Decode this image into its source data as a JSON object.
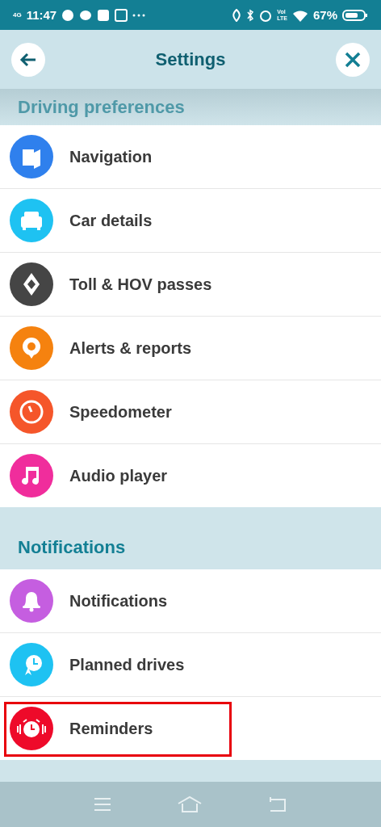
{
  "status_bar": {
    "network": "4G",
    "time": "11:47",
    "volte": [
      "Vol",
      "LTE"
    ],
    "battery": "67%"
  },
  "header": {
    "title": "Settings"
  },
  "sections": [
    {
      "title": "Driving preferences",
      "faded": true,
      "items": [
        {
          "label": "Navigation",
          "color": "#2f80ed",
          "highlighted": false
        },
        {
          "label": "Car details",
          "color": "#1ec2f2",
          "highlighted": false
        },
        {
          "label": "Toll & HOV passes",
          "color": "#454545",
          "highlighted": false
        },
        {
          "label": "Alerts & reports",
          "color": "#f5820f",
          "highlighted": false
        },
        {
          "label": "Speedometer",
          "color": "#f5562a",
          "highlighted": false
        },
        {
          "label": "Audio player",
          "color": "#f02d9c",
          "highlighted": false
        }
      ]
    },
    {
      "title": "Notifications",
      "faded": false,
      "items": [
        {
          "label": "Notifications",
          "color": "#c55ee0",
          "highlighted": false
        },
        {
          "label": "Planned drives",
          "color": "#1ec2f2",
          "highlighted": false
        },
        {
          "label": "Reminders",
          "color": "#ee0a2a",
          "highlighted": true
        }
      ]
    }
  ]
}
